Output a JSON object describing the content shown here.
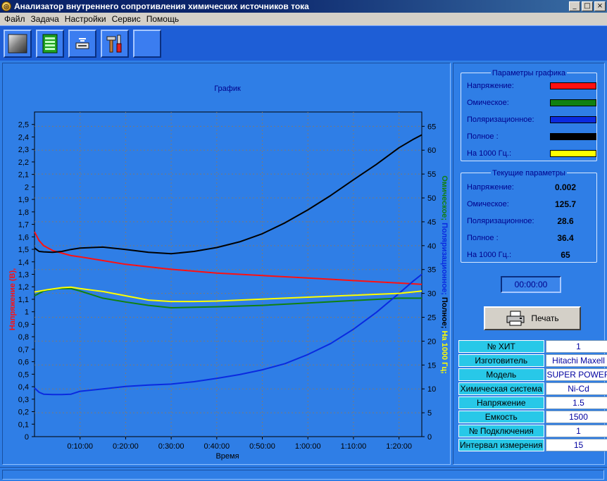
{
  "window": {
    "title": "Анализатор внутреннего сопротивления химических источников тока",
    "app_icon_glyph": "◎",
    "min_glyph": "_",
    "max_glyph": "□",
    "close_glyph": "×"
  },
  "menu": [
    "Файл",
    "Задача",
    "Настройки",
    "Сервис",
    "Помощь"
  ],
  "toolbar": {
    "buttons": [
      "new-task-icon",
      "table-icon",
      "device-icon",
      "tools-icon",
      "empty"
    ]
  },
  "colors": {
    "voltage": "#ff1010",
    "ohmic": "#108010",
    "polarization": "#0a2ae0",
    "total": "#000000",
    "hz1000": "#ffff00"
  },
  "chart_data": {
    "type": "line",
    "title": "График",
    "xlabel": "Время",
    "x_unit": "minutes",
    "xlim": [
      0,
      85
    ],
    "x_ticks": [
      10,
      20,
      30,
      40,
      50,
      60,
      70,
      80
    ],
    "x_tick_labels": [
      "0:10:00",
      "0:20:00",
      "0:30:00",
      "0:40:00",
      "0:50:00",
      "1:00:00",
      "1:10:00",
      "1:20:00"
    ],
    "y_left": {
      "label": "Напряжение (В),",
      "ylim": [
        0,
        2.6
      ],
      "ticks": [
        "0",
        "0,1",
        "0,2",
        "0,3",
        "0,4",
        "0,5",
        "0,6",
        "0,7",
        "0,8",
        "0,9",
        "1",
        "1,1",
        "1,2",
        "1,3",
        "1,4",
        "1,5",
        "1,6",
        "1,7",
        "1,8",
        "1,9",
        "2",
        "2,1",
        "2,2",
        "2,3",
        "2,4",
        "2,5"
      ]
    },
    "y_right": {
      "ylim": [
        0,
        68
      ],
      "ticks": [
        "0",
        "5",
        "10",
        "15",
        "20",
        "25",
        "30",
        "35",
        "40",
        "45",
        "50",
        "55",
        "60",
        "65"
      ],
      "labels": [
        "Омическое;",
        "Поляризационное;",
        "Полное;",
        "На 1000 Гц;"
      ]
    },
    "series": [
      {
        "name": "Напряжение",
        "axis": "left",
        "x": [
          0,
          1,
          2,
          4,
          6,
          8,
          10,
          15,
          20,
          25,
          30,
          40,
          50,
          60,
          70,
          80,
          85
        ],
        "y": [
          1.64,
          1.57,
          1.53,
          1.49,
          1.47,
          1.45,
          1.44,
          1.41,
          1.38,
          1.36,
          1.34,
          1.31,
          1.29,
          1.27,
          1.25,
          1.23,
          1.22
        ]
      },
      {
        "name": "Омическое",
        "axis": "right",
        "x": [
          0,
          2,
          5,
          8,
          10,
          15,
          20,
          25,
          30,
          40,
          50,
          60,
          70,
          80,
          85
        ],
        "y": [
          29.5,
          30.5,
          31,
          31,
          30.5,
          29,
          28.2,
          27.5,
          27,
          27.2,
          27.5,
          28,
          28.5,
          29,
          29
        ]
      },
      {
        "name": "Поляризационное",
        "axis": "right",
        "x": [
          0,
          1,
          2,
          4,
          6,
          8,
          10,
          15,
          20,
          25,
          30,
          35,
          40,
          45,
          50,
          55,
          60,
          65,
          70,
          75,
          80,
          83,
          85
        ],
        "y": [
          10.2,
          9.3,
          8.9,
          8.8,
          8.8,
          8.9,
          9.5,
          10,
          10.5,
          10.8,
          11,
          11.5,
          12.2,
          13,
          14,
          15.3,
          17.2,
          19.5,
          22.5,
          26,
          30,
          32.5,
          34
        ]
      },
      {
        "name": "Полное",
        "axis": "right",
        "x": [
          0,
          1,
          2,
          4,
          6,
          8,
          10,
          15,
          20,
          25,
          30,
          35,
          40,
          45,
          50,
          55,
          60,
          65,
          70,
          75,
          80,
          83,
          85
        ],
        "y": [
          39.5,
          38.8,
          38.7,
          38.6,
          38.8,
          39.2,
          39.5,
          39.7,
          39.2,
          38.6,
          38.3,
          38.8,
          39.6,
          40.8,
          42.5,
          44.8,
          47.5,
          50.5,
          53.8,
          57,
          60.5,
          62.2,
          63.2
        ]
      },
      {
        "name": "На 1000 Гц",
        "axis": "right",
        "x": [
          0,
          3,
          6,
          8,
          10,
          15,
          20,
          25,
          30,
          35,
          40,
          50,
          60,
          70,
          80,
          85
        ],
        "y": [
          30.3,
          30.8,
          31.2,
          31.3,
          31,
          30.4,
          29.5,
          28.6,
          28.3,
          28.3,
          28.4,
          28.8,
          29.2,
          29.6,
          30,
          30.5
        ]
      }
    ]
  },
  "graph_params": {
    "title": "Параметры графика",
    "rows": [
      {
        "label": "Напряжение:",
        "color": "#ff1010"
      },
      {
        "label": "Омическое:",
        "color": "#108010"
      },
      {
        "label": "Поляризационное:",
        "color": "#0a2ae0"
      },
      {
        "label": "Полное :",
        "color": "#000000"
      },
      {
        "label": "На 1000 Гц.:",
        "color": "#ffff00"
      }
    ]
  },
  "current_params": {
    "title": "Текущие параметры",
    "rows": [
      {
        "label": "Напряжение:",
        "value": "0.002"
      },
      {
        "label": "Омическое:",
        "value": "125.7"
      },
      {
        "label": "Поляризационное:",
        "value": "28.6"
      },
      {
        "label": "Полное :",
        "value": "36.4"
      },
      {
        "label": "На 1000 Гц.:",
        "value": "65"
      }
    ]
  },
  "timer": "00:00:00",
  "print_label": "Печать",
  "info": [
    {
      "key": "№ ХИТ",
      "value": "1"
    },
    {
      "key": "Изготовитель",
      "value": "Hitachi Maxell"
    },
    {
      "key": "Модель",
      "value": "SUPER POWER"
    },
    {
      "key": "Химическая система",
      "value": "Ni-Cd"
    },
    {
      "key": "Напряжение",
      "value": "1.5"
    },
    {
      "key": "Емкость",
      "value": "1500"
    },
    {
      "key": "№ Подключения",
      "value": "1"
    },
    {
      "key": "Интервал измерения",
      "value": "15"
    }
  ]
}
